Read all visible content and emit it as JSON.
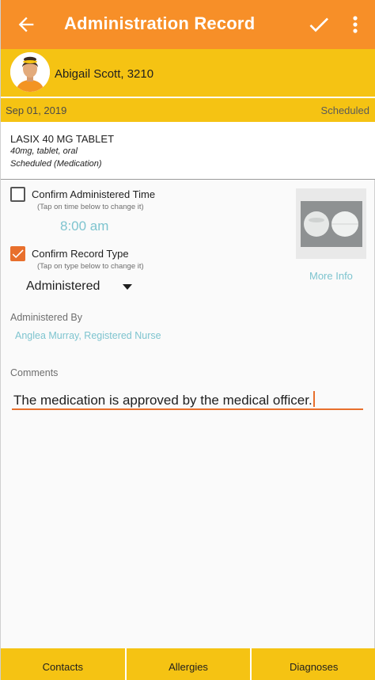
{
  "appbar": {
    "title": "Administration Record",
    "back_icon": "arrow-back-icon",
    "save_icon": "check-icon",
    "menu_icon": "more-vert-icon"
  },
  "patient": {
    "name": "Abigail Scott, 3210",
    "avatar_icon": "patient-avatar"
  },
  "schedule": {
    "date": "Sep 01, 2019",
    "status": "Scheduled"
  },
  "medication": {
    "name": "LASIX 40 MG TABLET",
    "detail": "40mg, tablet, oral",
    "schedule_type": "Scheduled (Medication)"
  },
  "confirm_time": {
    "label": "Confirm Administered Time",
    "hint": "(Tap on time below to change it)",
    "checked": false,
    "time": "8:00 am"
  },
  "confirm_type": {
    "label": "Confirm Record Type",
    "hint": "(Tap on type below to change it)",
    "checked": true,
    "selected_type": "Administered"
  },
  "pill": {
    "more_info_label": "More Info"
  },
  "administered_by": {
    "label": "Administered By",
    "value": "Anglea Murray, Registered Nurse"
  },
  "comments": {
    "label": "Comments",
    "value": "The medication is approved by the medical officer."
  },
  "bottom_tabs": {
    "contacts": "Contacts",
    "allergies": "Allergies",
    "diagnoses": "Diagnoses"
  },
  "colors": {
    "appbar": "#f78f28",
    "accent_yellow": "#f5c313",
    "link_teal": "#7ec4cf",
    "accent_orange": "#e86f2c"
  }
}
